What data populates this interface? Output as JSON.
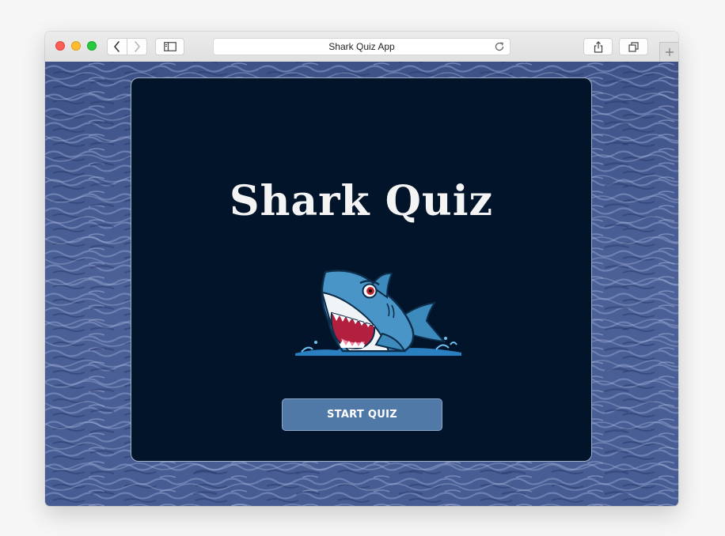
{
  "browser": {
    "address_bar": {
      "url_text": "Shark Quiz App"
    },
    "icons": {
      "back": "chevron-left-icon",
      "forward": "chevron-right-icon",
      "sidebar": "sidebar-icon",
      "reload": "reload-icon",
      "share": "share-icon",
      "tabs": "tabs-overview-icon",
      "new_tab": "plus-icon"
    }
  },
  "page": {
    "title": "Shark Quiz",
    "image": "shark-mascot",
    "start_button_label": "START QUIZ",
    "colors": {
      "card_background": "#01142a",
      "button_background": "#5079a8",
      "title_text": "#f4f4f4",
      "ocean": "#4a5f94"
    }
  }
}
